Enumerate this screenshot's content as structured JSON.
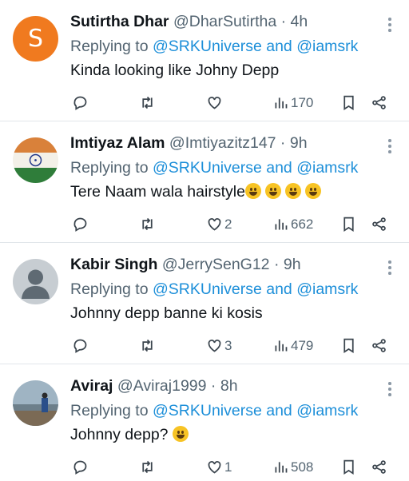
{
  "tweets": [
    {
      "name": "Sutirtha Dhar",
      "handle": "@DharSutirtha",
      "time": "4h",
      "avatar_letter": "S",
      "avatar_color": "#f07a1f",
      "reply_prefix": "Replying to",
      "mentions": "@SRKUniverse and @iamsrk",
      "text": "Kinda looking like Johny Depp",
      "likes": "",
      "views": "170"
    },
    {
      "name": "Imtiyaz Alam",
      "handle": "@Imtiyazitz147",
      "time": "9h",
      "avatar": "india-flag",
      "reply_prefix": "Replying to",
      "mentions": "@SRKUniverse and @iamsrk",
      "text": "Tere Naam wala hairstyle",
      "likes": "2",
      "views": "662"
    },
    {
      "name": "Kabir Singh",
      "handle": "@JerrySenG12",
      "time": "9h",
      "avatar": "default-user",
      "reply_prefix": "Replying to",
      "mentions": "@SRKUniverse and @iamsrk",
      "text": "Johnny depp banne ki kosis",
      "likes": "3",
      "views": "479"
    },
    {
      "name": "Aviraj",
      "handle": "@Aviraj1999",
      "time": "8h",
      "avatar": "photo",
      "reply_prefix": "Replying to",
      "mentions": "@SRKUniverse and @iamsrk",
      "text": "Johnny depp?",
      "likes": "1",
      "views": "508"
    }
  ],
  "colors": {
    "link": "#1d8fd9",
    "muted": "#536471",
    "text": "#0f1419"
  }
}
